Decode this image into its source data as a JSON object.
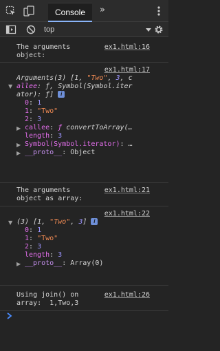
{
  "toolbar": {
    "tab_label": "Console",
    "more_tabs": "»"
  },
  "filter": {
    "context": "top"
  },
  "messages": {
    "m1": {
      "text1": "The arguments",
      "text2": "object:",
      "source": "ex1.html:16"
    },
    "m2": {
      "source": "ex1.html:17",
      "summary": {
        "head": "Arguments(3) [1, ",
        "s1": "\"Two\"",
        "mid": ", ",
        "n3": "3",
        "tail": ", c"
      },
      "summary2": {
        "key": "allee",
        "rest": ": ƒ, Symbol(Symbol.iter"
      },
      "summary3": "ator): ƒ]",
      "items": [
        {
          "key": "0",
          "val": "1"
        },
        {
          "key": "1",
          "val": "\"Two\""
        },
        {
          "key": "2",
          "val": "3"
        }
      ],
      "callee": {
        "key": "callee",
        "rest": ": ",
        "f": "ƒ",
        "fname": " convertToArray(…"
      },
      "length": {
        "key": "length",
        "val": "3"
      },
      "symbol": {
        "key": "Symbol(Symbol.iterator)",
        "rest": ": …"
      },
      "proto": {
        "key": "__proto__",
        "val": ": Object"
      }
    },
    "m3": {
      "text1": "The arguments",
      "text2": "object as array:",
      "source": "ex1.html:21"
    },
    "m4": {
      "source": "ex1.html:22",
      "summary": {
        "head": "(3) [1, ",
        "s1": "\"Two\"",
        "mid": ", ",
        "n3": "3",
        "tail": "]"
      },
      "items": [
        {
          "key": "0",
          "val": "1"
        },
        {
          "key": "1",
          "val": "\"Two\""
        },
        {
          "key": "2",
          "val": "3"
        }
      ],
      "length": {
        "key": "length",
        "val": "3"
      },
      "proto": {
        "key": "__proto__",
        "val": ": Array(0)"
      }
    },
    "m5": {
      "text1": "Using join() on",
      "text2": "array:  1,Two,3",
      "source": "ex1.html:26"
    }
  },
  "colors": {
    "accent": "#8ab4f8",
    "background": "#242424",
    "prompt": "#4a8cff"
  }
}
